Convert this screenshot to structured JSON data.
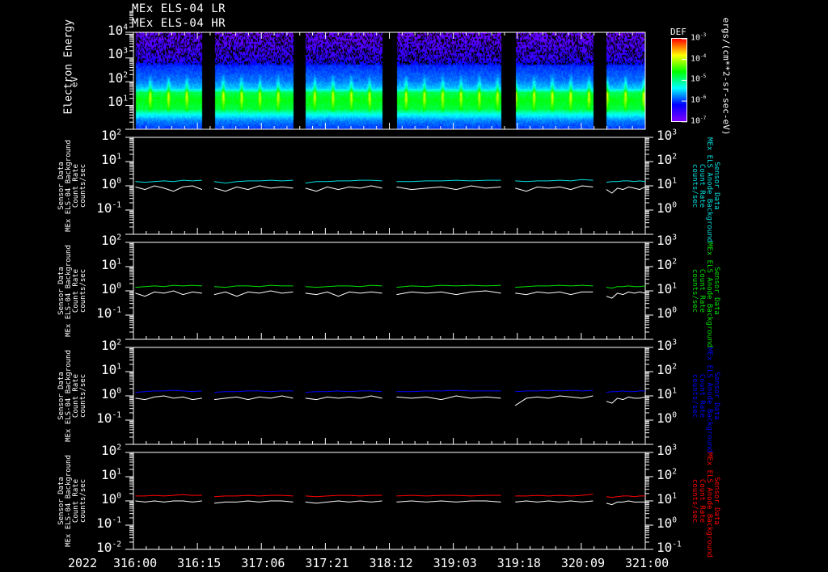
{
  "titles": [
    "MEx ELS-04 LR",
    "MEx ELS-04 HR"
  ],
  "colors": {
    "background": "#000000",
    "axes": "#ffffff",
    "panel1": "#00e0e0",
    "panel2": "#00e000",
    "panel3": "#0000ff",
    "panel4": "#ff0000",
    "reference": "#ffffff"
  },
  "chart_data": [
    {
      "type": "heatmap",
      "ylabel": "Electron Energy",
      "yunit": "eV",
      "yscale": "log",
      "ylim": [
        0.8,
        10000
      ],
      "yticks": [
        {
          "base": "10",
          "exp": "4",
          "v": 10000
        },
        {
          "base": "10",
          "exp": "3",
          "v": 1000
        },
        {
          "base": "10",
          "exp": "2",
          "v": 100
        },
        {
          "base": "10",
          "exp": "1",
          "v": 10
        }
      ],
      "xlim": [
        316.0,
        321.0
      ],
      "data_segments": [
        [
          316.02,
          316.67
        ],
        [
          316.79,
          317.56
        ],
        [
          317.68,
          318.43
        ],
        [
          318.57,
          319.59
        ],
        [
          319.73,
          320.49
        ],
        [
          320.62,
          321.0
        ]
      ],
      "typical_spectrum": [
        [
          0.8,
          4e-07
        ],
        [
          2,
          8e-07
        ],
        [
          4,
          3e-06
        ],
        [
          6,
          1e-05
        ],
        [
          15,
          1.5e-05
        ],
        [
          30,
          9e-06
        ],
        [
          45,
          1.5e-06
        ],
        [
          100,
          7e-07
        ],
        [
          400,
          4e-07
        ],
        [
          700,
          2e-07
        ],
        [
          10000,
          1.2e-07
        ]
      ],
      "colorbar": {
        "label": "DEF",
        "unit": "ergs/(cm**2-sr-sec-eV)",
        "scale": "log",
        "range": [
          1e-07,
          0.001
        ],
        "ticks": [
          {
            "base": "10",
            "exp": "-3"
          },
          {
            "base": "10",
            "exp": "-4"
          },
          {
            "base": "10",
            "exp": "-5"
          },
          {
            "base": "10",
            "exp": "-6"
          },
          {
            "base": "10",
            "exp": "-7"
          }
        ]
      }
    },
    {
      "type": "line",
      "left_label": [
        "Sensor Data",
        "MEx ELS-04 Background",
        "Count Rate",
        "counts/sec"
      ],
      "right_label": [
        "Sensor Data",
        "MEx ELS Anode Background",
        "Count Rate",
        "counts/sec"
      ],
      "color_key": "panel1",
      "left_ylim": [
        0.01,
        100
      ],
      "right_ylim": [
        0.1,
        1000
      ],
      "segments": [
        [
          316.02,
          316.67
        ],
        [
          316.79,
          317.56
        ],
        [
          317.68,
          318.43
        ],
        [
          318.57,
          319.59
        ],
        [
          319.73,
          320.49
        ],
        [
          320.62,
          321.0
        ]
      ],
      "series": [
        {
          "values": [
            [
              1.5,
              1.4,
              1.5,
              1.6,
              1.5,
              1.7,
              1.6,
              1.7
            ],
            [
              1.5,
              1.3,
              1.5,
              1.6,
              1.6,
              1.7,
              1.6,
              1.7
            ],
            [
              1.3,
              1.5,
              1.5,
              1.6,
              1.6,
              1.7,
              1.7,
              1.6
            ],
            [
              1.5,
              1.5,
              1.6,
              1.6,
              1.7,
              1.6,
              1.7,
              1.7
            ],
            [
              1.6,
              1.5,
              1.6,
              1.6,
              1.7,
              1.6,
              1.8,
              1.7
            ],
            [
              1.4,
              1.5,
              1.5,
              1.6,
              1.6,
              1.5,
              1.6,
              1.5
            ]
          ]
        },
        {
          "values": [
            [
              0.9,
              0.7,
              1.0,
              0.8,
              0.6,
              0.9,
              1.0,
              0.7
            ],
            [
              0.8,
              0.6,
              0.9,
              0.7,
              1.0,
              0.8,
              0.9,
              0.8
            ],
            [
              0.8,
              0.6,
              0.9,
              0.7,
              0.9,
              0.8,
              1.0,
              0.8
            ],
            [
              0.9,
              0.7,
              0.8,
              0.9,
              0.7,
              1.0,
              0.8,
              0.9
            ],
            [
              0.8,
              0.6,
              0.9,
              0.8,
              0.9,
              0.7,
              1.0,
              0.9
            ],
            [
              0.7,
              0.5,
              0.8,
              0.7,
              0.9,
              0.8,
              0.7,
              0.9
            ]
          ]
        }
      ]
    },
    {
      "type": "line",
      "left_label": [
        "Sensor Data",
        "MEx ELS-04 Background",
        "Count Rate",
        "counts/sec"
      ],
      "right_label": [
        "Sensor Data",
        "MEx ELS Anode Background",
        "Count Rate",
        "counts/sec"
      ],
      "color_key": "panel2",
      "left_ylim": [
        0.01,
        100
      ],
      "right_ylim": [
        0.1,
        1000
      ],
      "segments": [
        [
          316.02,
          316.67
        ],
        [
          316.79,
          317.56
        ],
        [
          317.68,
          318.43
        ],
        [
          318.57,
          319.59
        ],
        [
          319.73,
          320.49
        ],
        [
          320.62,
          321.0
        ]
      ],
      "series": [
        {
          "values": [
            [
              1.4,
              1.5,
              1.6,
              1.5,
              1.7,
              1.6,
              1.7,
              1.6
            ],
            [
              1.5,
              1.4,
              1.6,
              1.6,
              1.5,
              1.7,
              1.6,
              1.6
            ],
            [
              1.5,
              1.4,
              1.5,
              1.6,
              1.6,
              1.5,
              1.7,
              1.6
            ],
            [
              1.4,
              1.6,
              1.5,
              1.7,
              1.6,
              1.7,
              1.6,
              1.7
            ],
            [
              1.4,
              1.5,
              1.6,
              1.6,
              1.7,
              1.6,
              1.7,
              1.6
            ],
            [
              1.4,
              1.3,
              1.5,
              1.5,
              1.6,
              1.5,
              1.5,
              1.6
            ]
          ]
        },
        {
          "values": [
            [
              0.8,
              0.6,
              0.9,
              0.8,
              1.0,
              0.7,
              0.9,
              0.8
            ],
            [
              0.7,
              0.9,
              0.6,
              0.9,
              0.8,
              1.0,
              0.8,
              0.9
            ],
            [
              0.8,
              0.7,
              0.9,
              0.6,
              0.9,
              0.8,
              0.9,
              0.8
            ],
            [
              0.7,
              0.9,
              0.8,
              0.9,
              0.7,
              0.9,
              1.0,
              0.8
            ],
            [
              0.8,
              0.7,
              0.9,
              0.8,
              0.9,
              0.7,
              0.9,
              0.9
            ],
            [
              0.6,
              0.5,
              0.8,
              0.7,
              0.9,
              0.8,
              0.9,
              0.8
            ]
          ]
        }
      ]
    },
    {
      "type": "line",
      "left_label": [
        "Sensor Data",
        "MEx ELS-04 Background",
        "Count Rate",
        "counts/sec"
      ],
      "right_label": [
        "Sensor Data",
        "MEx ELS Anode Background",
        "Count Rate",
        "counts/sec"
      ],
      "color_key": "panel3",
      "left_ylim": [
        0.01,
        100
      ],
      "right_ylim": [
        0.1,
        1000
      ],
      "segments": [
        [
          316.02,
          316.67
        ],
        [
          316.79,
          317.56
        ],
        [
          317.68,
          318.43
        ],
        [
          318.57,
          319.59
        ],
        [
          319.73,
          320.49
        ],
        [
          320.62,
          321.0
        ]
      ],
      "series": [
        {
          "values": [
            [
              1.4,
              1.5,
              1.6,
              1.6,
              1.7,
              1.6,
              1.5,
              1.6
            ],
            [
              1.4,
              1.5,
              1.5,
              1.6,
              1.6,
              1.5,
              1.6,
              1.6
            ],
            [
              1.4,
              1.5,
              1.5,
              1.6,
              1.5,
              1.6,
              1.6,
              1.5
            ],
            [
              1.5,
              1.5,
              1.6,
              1.6,
              1.7,
              1.6,
              1.6,
              1.6
            ],
            [
              1.5,
              1.6,
              1.6,
              1.7,
              1.6,
              1.7,
              1.6,
              1.7
            ],
            [
              1.4,
              1.5,
              1.5,
              1.6,
              1.5,
              1.5,
              1.6,
              1.6
            ]
          ]
        },
        {
          "values": [
            [
              0.8,
              0.7,
              0.9,
              1.0,
              0.8,
              0.9,
              0.7,
              0.8
            ],
            [
              0.7,
              0.8,
              0.9,
              0.7,
              0.9,
              0.8,
              1.0,
              0.8
            ],
            [
              0.8,
              0.7,
              0.9,
              0.8,
              0.9,
              0.8,
              1.0,
              0.8
            ],
            [
              0.9,
              0.8,
              0.9,
              0.7,
              1.0,
              0.8,
              0.9,
              0.8
            ],
            [
              0.4,
              0.8,
              0.9,
              0.8,
              1.0,
              0.9,
              0.8,
              1.0
            ],
            [
              0.6,
              0.5,
              0.8,
              0.7,
              0.9,
              0.8,
              0.8,
              0.9
            ]
          ]
        }
      ]
    },
    {
      "type": "line",
      "left_label": [
        "Sensor Data",
        "MEx ELS-04 Background",
        "Count Rate",
        "counts/sec"
      ],
      "right_label": [
        "Sensor Data",
        "MEx ELS Anode Background",
        "Count Rate",
        "counts/sec"
      ],
      "color_key": "panel4",
      "left_ylim": [
        0.01,
        100
      ],
      "right_ylim": [
        0.1,
        1000
      ],
      "segments": [
        [
          316.02,
          316.67
        ],
        [
          316.79,
          317.56
        ],
        [
          317.68,
          318.43
        ],
        [
          318.57,
          319.59
        ],
        [
          319.73,
          320.49
        ],
        [
          320.62,
          321.0
        ]
      ],
      "series": [
        {
          "values": [
            [
              1.6,
              1.6,
              1.7,
              1.6,
              1.7,
              1.8,
              1.7,
              1.7
            ],
            [
              1.5,
              1.6,
              1.6,
              1.7,
              1.6,
              1.7,
              1.7,
              1.6
            ],
            [
              1.6,
              1.5,
              1.6,
              1.7,
              1.7,
              1.6,
              1.7,
              1.7
            ],
            [
              1.6,
              1.7,
              1.6,
              1.7,
              1.7,
              1.6,
              1.7,
              1.7
            ],
            [
              1.6,
              1.6,
              1.7,
              1.6,
              1.7,
              1.6,
              1.7,
              1.9
            ],
            [
              1.5,
              1.4,
              1.5,
              1.6,
              1.6,
              1.5,
              1.6,
              1.6
            ]
          ]
        },
        {
          "values": [
            [
              1.0,
              0.9,
              1.0,
              0.9,
              1.0,
              1.0,
              0.9,
              1.0
            ],
            [
              0.8,
              0.9,
              0.9,
              1.0,
              0.9,
              1.0,
              1.0,
              0.9
            ],
            [
              0.9,
              0.8,
              0.9,
              1.0,
              0.9,
              1.0,
              0.9,
              1.0
            ],
            [
              0.9,
              1.0,
              0.9,
              1.0,
              0.9,
              1.0,
              1.0,
              0.9
            ],
            [
              0.9,
              1.0,
              0.9,
              1.0,
              0.9,
              1.0,
              0.9,
              1.0
            ],
            [
              0.8,
              0.7,
              0.9,
              0.9,
              1.0,
              0.9,
              0.9,
              0.9
            ]
          ]
        }
      ]
    }
  ],
  "panel_yticks": {
    "left": [
      {
        "base": "10",
        "exp": "2"
      },
      {
        "base": "10",
        "exp": "1"
      },
      {
        "base": "10",
        "exp": "0"
      },
      {
        "base": "10",
        "exp": "-1"
      },
      {
        "base": "10",
        "exp": "-2"
      }
    ],
    "right": [
      {
        "base": "10",
        "exp": "3"
      },
      {
        "base": "10",
        "exp": "2"
      },
      {
        "base": "10",
        "exp": "1"
      },
      {
        "base": "10",
        "exp": "0"
      },
      {
        "base": "10",
        "exp": "-1"
      }
    ]
  },
  "xaxis": {
    "year": "2022",
    "xlim": [
      316.0,
      321.0
    ],
    "ticks": [
      {
        "label": "316:00",
        "v": 316.0
      },
      {
        "label": "316:15",
        "v": 316.625
      },
      {
        "label": "317:06",
        "v": 317.25
      },
      {
        "label": "317:21",
        "v": 317.875
      },
      {
        "label": "318:12",
        "v": 318.5
      },
      {
        "label": "319:03",
        "v": 319.125
      },
      {
        "label": "319:18",
        "v": 319.75
      },
      {
        "label": "320:09",
        "v": 320.375
      },
      {
        "label": "321:00",
        "v": 321.0
      }
    ]
  }
}
